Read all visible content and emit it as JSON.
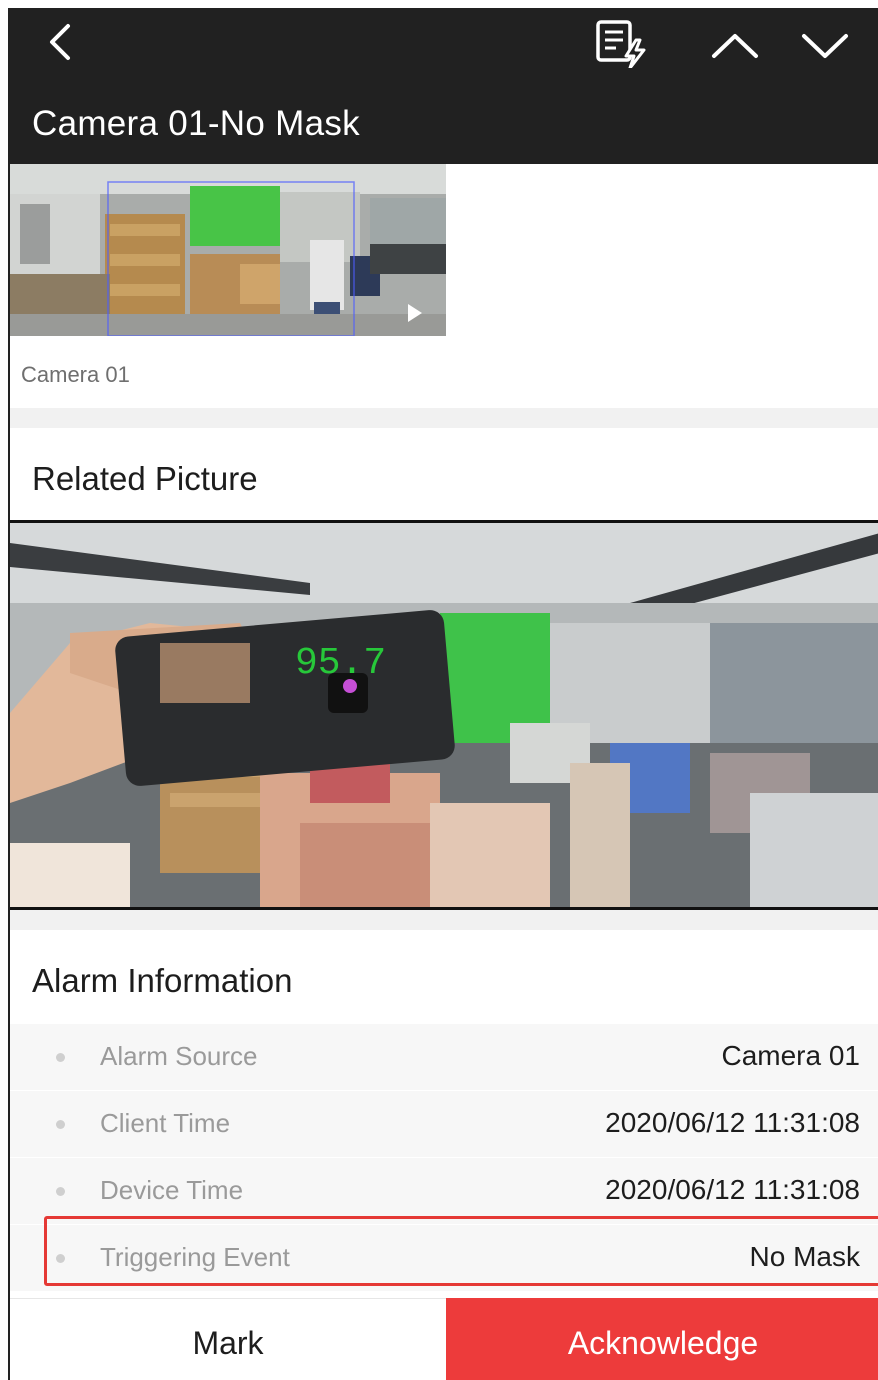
{
  "header": {
    "title": "Camera 01-No Mask",
    "icons": [
      "back-chevron-icon",
      "event-list-icon",
      "chevron-up-icon",
      "chevron-down-icon"
    ]
  },
  "video": {
    "camera_label": "Camera 01",
    "play_icon": "play-icon"
  },
  "related_picture": {
    "title": "Related Picture",
    "overlay_temperature": "95.7"
  },
  "alarm_info": {
    "title": "Alarm Information",
    "rows": [
      {
        "label": "Alarm Source",
        "value": "Camera 01"
      },
      {
        "label": "Client Time",
        "value": "2020/06/12 11:31:08"
      },
      {
        "label": "Device Time",
        "value": "2020/06/12 11:31:08"
      },
      {
        "label": "Triggering Event",
        "value": "No Mask"
      }
    ],
    "highlight_color": "#e53935"
  },
  "footer": {
    "mark_label": "Mark",
    "acknowledge_label": "Acknowledge",
    "acknowledge_color": "#ed3b3b"
  }
}
